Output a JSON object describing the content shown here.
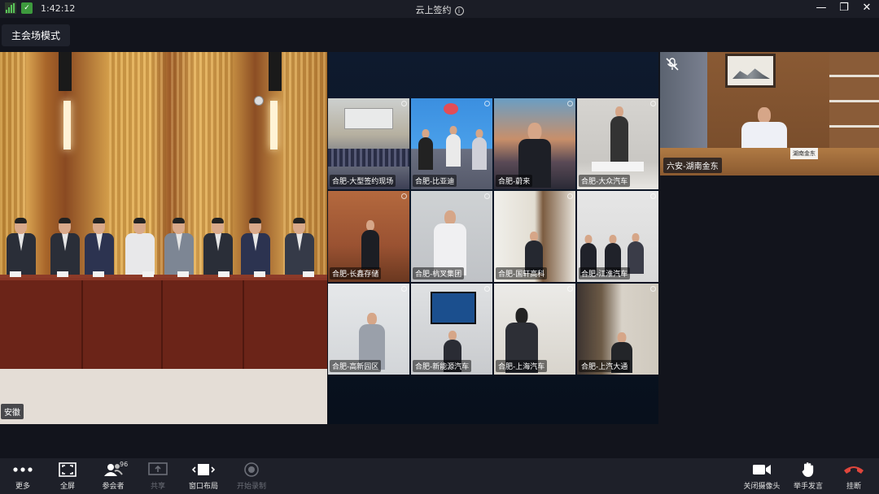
{
  "status": {
    "time": "1:42:12"
  },
  "window": {
    "title": "云上签约",
    "info_icon": "info-icon",
    "controls": [
      "minimize-icon",
      "maximize-icon",
      "close-icon"
    ]
  },
  "mode_button": "主会场模式",
  "main_venue": {
    "label": "安徽"
  },
  "grid": {
    "cells": [
      {
        "label": "合肥-大型签约现场"
      },
      {
        "label": "合肥-比亚迪"
      },
      {
        "label": "合肥-蔚来"
      },
      {
        "label": "合肥-大众汽车"
      },
      {
        "label": "合肥-长鑫存储"
      },
      {
        "label": "合肥-杭叉集团"
      },
      {
        "label": "合肥-国轩高科"
      },
      {
        "label": "合肥-江淮汽车"
      },
      {
        "label": "合肥-高新园区"
      },
      {
        "label": "合肥-新能源汽车"
      },
      {
        "label": "合肥-上海汽车"
      },
      {
        "label": "合肥-上汽大通"
      }
    ]
  },
  "right_venue": {
    "label": "六安-湖南金东",
    "nameplate": "湖南金东",
    "muted": true
  },
  "toolbar": {
    "left": [
      {
        "label": "更多",
        "icon": "more-icon",
        "enabled": true
      },
      {
        "label": "全屏",
        "icon": "fullscreen-icon",
        "enabled": true
      },
      {
        "label": "参会者",
        "icon": "participants-icon",
        "enabled": true,
        "count": "96"
      },
      {
        "label": "共享",
        "icon": "share-icon",
        "enabled": false
      },
      {
        "label": "窗口布局",
        "icon": "layout-icon",
        "enabled": true
      },
      {
        "label": "开始录制",
        "icon": "record-icon",
        "enabled": false
      }
    ],
    "right": [
      {
        "label": "关闭摄像头",
        "icon": "camera-icon"
      },
      {
        "label": "举手发言",
        "icon": "raise-hand-icon"
      },
      {
        "label": "挂断",
        "icon": "hangup-icon"
      }
    ]
  },
  "colors": {
    "hangup": "#e0463c",
    "toolbar_bg": "#1e2029",
    "signal": "#59c35a"
  }
}
